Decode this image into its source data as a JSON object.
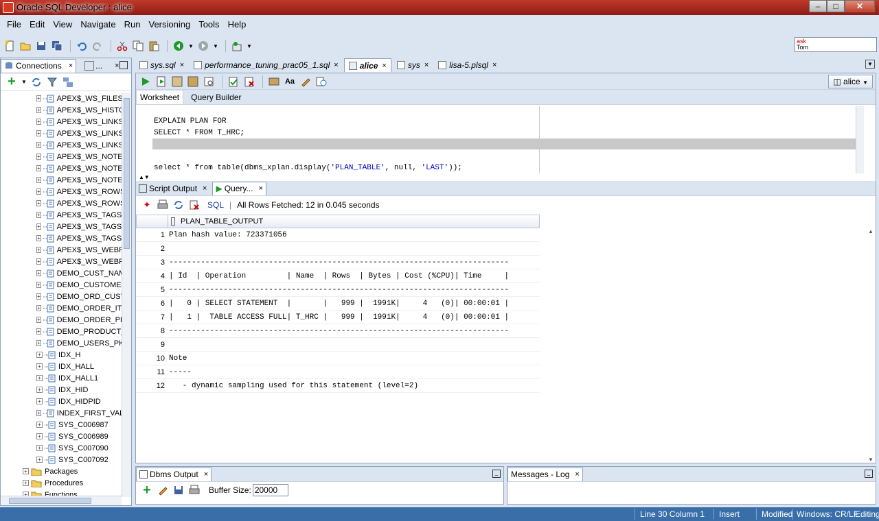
{
  "window": {
    "title": "Oracle SQL Developer : alice"
  },
  "menu": [
    "File",
    "Edit",
    "View",
    "Navigate",
    "Run",
    "Versioning",
    "Tools",
    "Help"
  ],
  "ask_box": {
    "line1": "ask",
    "line2": "Tom"
  },
  "left_panel": {
    "tab_connections": "Connections",
    "tab_second": "...",
    "tree_items": [
      "APEX$_WS_FILES_",
      "APEX$_WS_HISTO",
      "APEX$_WS_LINKS_",
      "APEX$_WS_LINKS_",
      "APEX$_WS_LINKS_",
      "APEX$_WS_NOTES",
      "APEX$_WS_NOTES",
      "APEX$_WS_NOTES",
      "APEX$_WS_ROWS",
      "APEX$_WS_ROWS",
      "APEX$_WS_TAGS_",
      "APEX$_WS_TAGS_",
      "APEX$_WS_TAGS_",
      "APEX$_WS_WEBPC",
      "APEX$_WS_WEBPC",
      "DEMO_CUST_NAM",
      "DEMO_CUSTOMER",
      "DEMO_ORD_CUST",
      "DEMO_ORDER_ITE",
      "DEMO_ORDER_PK",
      "DEMO_PRODUCT_",
      "DEMO_USERS_PK",
      "IDX_H",
      "IDX_HALL",
      "IDX_HALL1",
      "IDX_HID",
      "IDX_HIDPID",
      "INDEX_FIRST_VAL",
      "SYS_C006987",
      "SYS_C006989",
      "SYS_C007090",
      "SYS_C007092"
    ],
    "folders": [
      "Packages",
      "Procedures",
      "Functions"
    ]
  },
  "editor_tabs": [
    {
      "label": "sys.sql",
      "active": false
    },
    {
      "label": "performance_tuning_prac05_1.sql",
      "active": false
    },
    {
      "label": "alice",
      "active": true
    },
    {
      "label": "sys",
      "active": false
    },
    {
      "label": "lisa-5.plsql",
      "active": false
    }
  ],
  "connection": "alice",
  "sub_tabs": {
    "worksheet": "Worksheet",
    "query_builder": "Query Builder"
  },
  "code": {
    "line1": "EXPLAIN PLAN FOR",
    "line2": "SELECT * FROM T_HRC;",
    "line4_pre": "select * from table(dbms_xplan.display(",
    "line4_s1": "'PLAN_TABLE'",
    "line4_mid": ", null, ",
    "line4_s2": "'LAST'",
    "line4_post": "));"
  },
  "results": {
    "tab_script_output": "Script Output",
    "tab_query": "Query...",
    "sql_link": "SQL",
    "status": "All Rows Fetched: 12 in 0.045 seconds",
    "column": "PLAN_TABLE_OUTPUT",
    "rows": [
      {
        "n": "1",
        "v": "Plan hash value: 723371056"
      },
      {
        "n": "2",
        "v": ""
      },
      {
        "n": "3",
        "v": "---------------------------------------------------------------------------"
      },
      {
        "n": "4",
        "v": "| Id  | Operation         | Name  | Rows  | Bytes | Cost (%CPU)| Time     |"
      },
      {
        "n": "5",
        "v": "---------------------------------------------------------------------------"
      },
      {
        "n": "6",
        "v": "|   0 | SELECT STATEMENT  |       |   999 |  1991K|     4   (0)| 00:00:01 |"
      },
      {
        "n": "7",
        "v": "|   1 |  TABLE ACCESS FULL| T_HRC |   999 |  1991K|     4   (0)| 00:00:01 |"
      },
      {
        "n": "8",
        "v": "---------------------------------------------------------------------------"
      },
      {
        "n": "9",
        "v": ""
      },
      {
        "n": "10",
        "v": "Note"
      },
      {
        "n": "11",
        "v": "-----"
      },
      {
        "n": "12",
        "v": "   - dynamic sampling used for this statement (level=2)"
      }
    ]
  },
  "dbms_output": {
    "tab": "Dbms Output",
    "buffer_label": "Buffer Size:",
    "buffer_value": "20000"
  },
  "messages": {
    "tab": "Messages - Log"
  },
  "status_bar": {
    "position": "Line 30 Column 1",
    "mode": "Insert",
    "state": "Modified",
    "line_endings": "Windows: CR/LF",
    "editing": "Editing"
  },
  "colors": {
    "titlebar": "#a8281b",
    "chrome": "#dbe5f1",
    "statusbar": "#3a6ea8",
    "run_green": "#1e9a2a"
  },
  "icons": [
    "new-file-icon",
    "open-folder-icon",
    "save-icon",
    "save-all-icon",
    "undo-icon",
    "redo-icon",
    "cut-icon",
    "copy-icon",
    "paste-icon",
    "back-icon",
    "forward-icon",
    "sql-icon",
    "run-icon",
    "pin-icon",
    "print-icon",
    "refresh-icon",
    "add-icon",
    "eraser-icon"
  ]
}
